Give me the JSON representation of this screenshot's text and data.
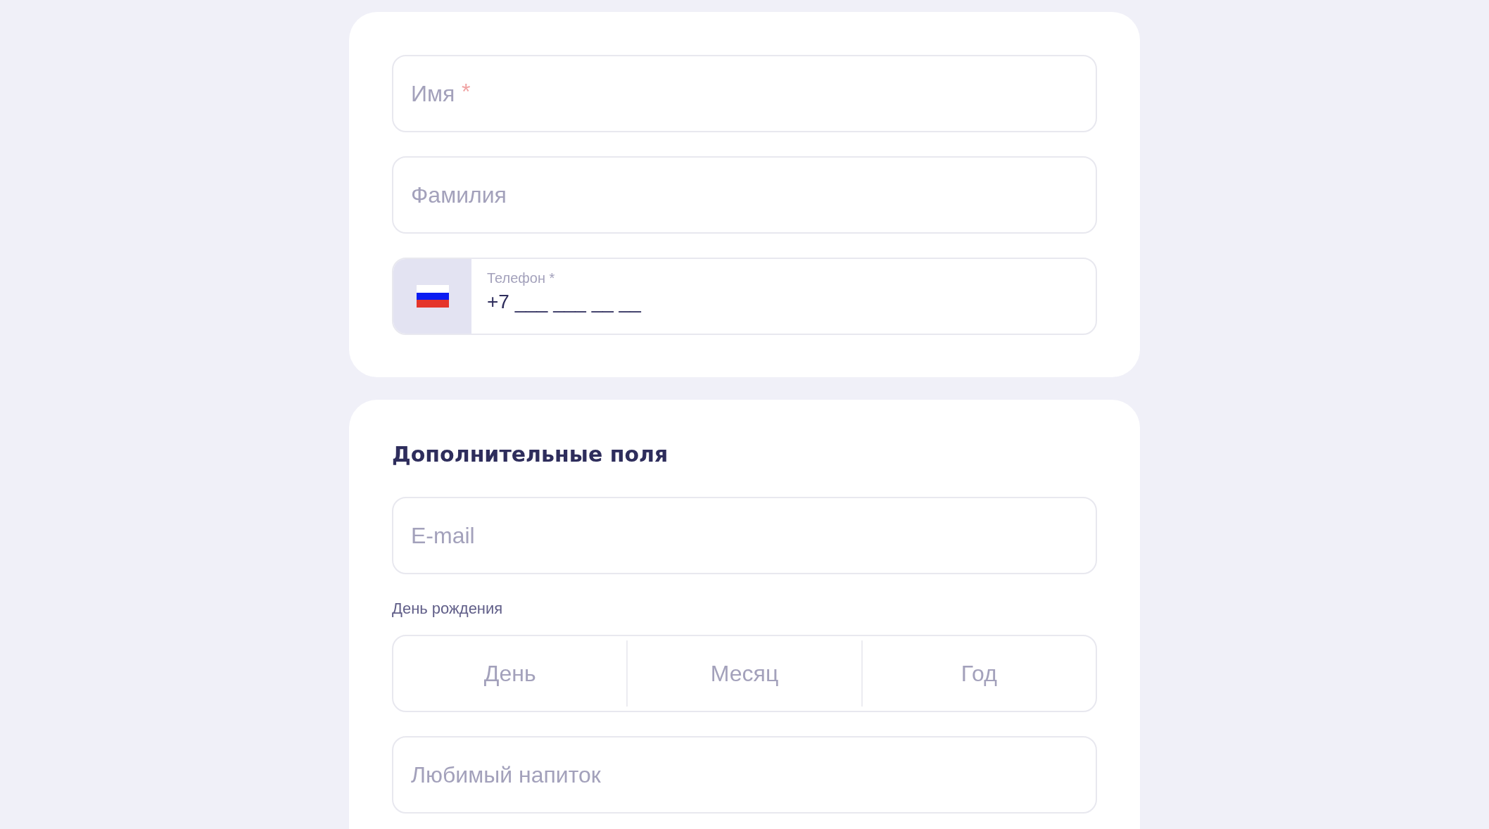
{
  "cards": [
    {
      "fields": [
        {
          "kind": "text",
          "placeholder": "Имя",
          "required_mark": "*"
        },
        {
          "kind": "text",
          "placeholder": "Фамилия"
        },
        {
          "kind": "phone",
          "label": "Телефон *",
          "value": "+7 ___ ___ __ __"
        }
      ]
    },
    {
      "title": "Дополнительные поля",
      "fields": [
        {
          "kind": "text",
          "placeholder": "E-mail"
        },
        {
          "kind": "date",
          "label": "День рождения",
          "parts": [
            {
              "placeholder": "День"
            },
            {
              "placeholder": "Месяц"
            },
            {
              "placeholder": "Год"
            }
          ]
        },
        {
          "kind": "text",
          "placeholder": "Любимый напиток"
        }
      ]
    }
  ]
}
